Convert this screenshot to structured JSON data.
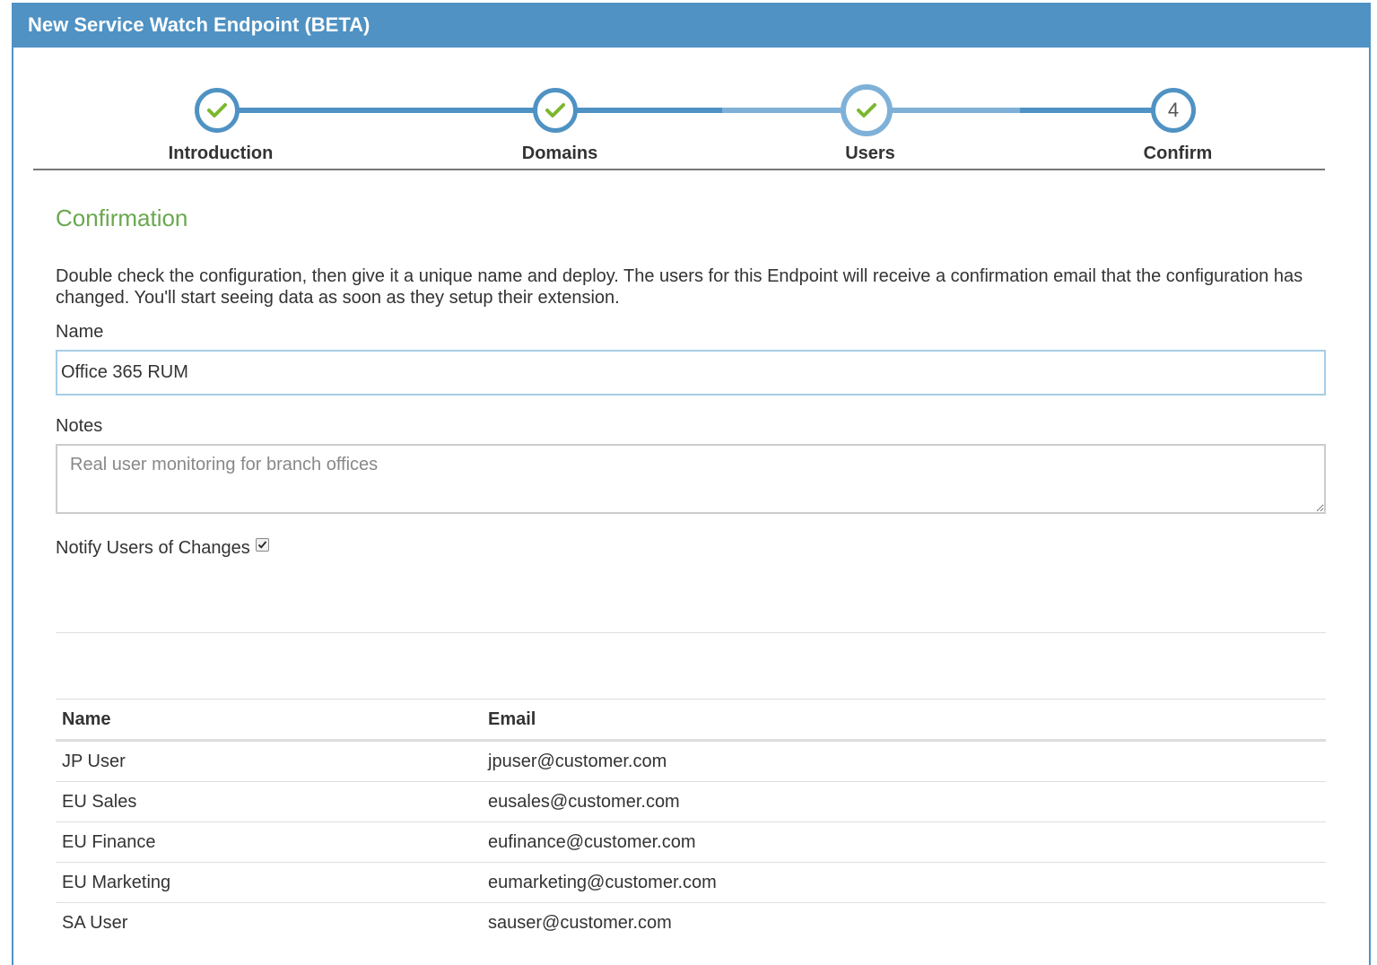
{
  "window": {
    "title": "New Service Watch Endpoint (BETA)"
  },
  "wizard": {
    "steps": [
      {
        "label": "Introduction",
        "state": "complete",
        "icon": "checkmark-icon"
      },
      {
        "label": "Domains",
        "state": "complete",
        "icon": "checkmark-icon"
      },
      {
        "label": "Users",
        "state": "complete-active",
        "icon": "checkmark-icon"
      },
      {
        "label": "Confirm",
        "state": "pending",
        "number": "4"
      }
    ]
  },
  "confirmation": {
    "title": "Confirmation",
    "description": "Double check the configuration, then give it a unique name and deploy. The users for this Endpoint will receive a confirmation email that the configuration has changed. You'll start seeing data as soon as they setup their extension."
  },
  "form": {
    "name_label": "Name",
    "name_value": "Office 365 RUM",
    "notes_label": "Notes",
    "notes_placeholder": "Real user monitoring for branch offices",
    "notify_label": "Notify Users of Changes",
    "notify_checked": true
  },
  "users_table": {
    "columns": [
      "Name",
      "Email"
    ],
    "rows": [
      {
        "name": "JP User",
        "email": "jpuser@customer.com"
      },
      {
        "name": "EU Sales",
        "email": "eusales@customer.com"
      },
      {
        "name": "EU Finance",
        "email": "eufinance@customer.com"
      },
      {
        "name": "EU Marketing",
        "email": "eumarketing@customer.com"
      },
      {
        "name": "SA User",
        "email": "sauser@customer.com"
      }
    ]
  },
  "colors": {
    "header_blue": "#4f92c3",
    "light_blue": "#7fb1d8",
    "success_green": "#6aa84f",
    "check_green": "#7cb82f"
  }
}
